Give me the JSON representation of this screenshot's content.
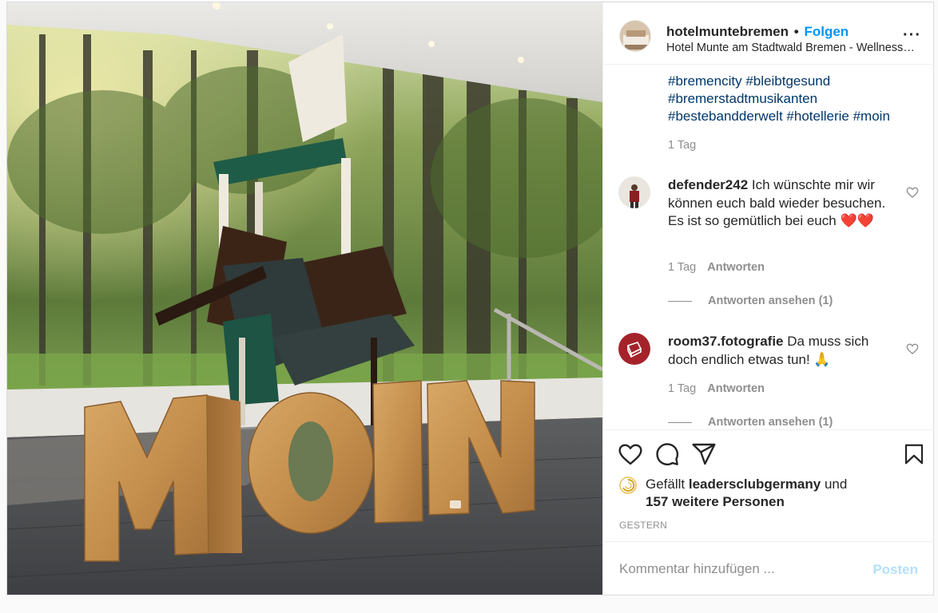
{
  "header": {
    "username": "hotelmuntebremen",
    "separator": "•",
    "follow_label": "Folgen",
    "location": "Hotel Munte am Stadtwald Bremen - Wellness- & Tagungshotel",
    "more_icon": "more-horizontal-icon"
  },
  "caption": {
    "tags": [
      "#bremencity",
      "#bleibtgesund",
      "#bremerstadtmusikanten",
      "#bestebandderwelt",
      "#hotellerie",
      "#moin"
    ],
    "time": "1 Tag"
  },
  "comments": [
    {
      "username": "defender242",
      "text": "Ich wünschte mir wir können euch bald wieder besuchen. Es ist so gemütlich bei euch ❤️❤️",
      "time": "1 Tag",
      "reply_label": "Antworten",
      "view_replies": "Antworten ansehen (1)"
    },
    {
      "username": "room37.fotografie",
      "text": "Da muss sich doch endlich etwas tun! 🙏",
      "time": "1 Tag",
      "reply_label": "Antworten",
      "view_replies": "Antworten ansehen (1)"
    }
  ],
  "actions": {
    "icons": [
      "heart-icon",
      "comment-icon",
      "share-icon",
      "bookmark-icon"
    ],
    "likes_prefix": "Gefällt",
    "likes_user": "leadersclubgermany",
    "likes_and": "und",
    "likes_others": "157 weitere Personen",
    "date": "GESTERN"
  },
  "add_comment": {
    "placeholder": "Kommentar hinzufügen ...",
    "post_label": "Posten"
  },
  "photo": {
    "letters": [
      "M",
      "O",
      "I",
      "N"
    ]
  },
  "colors": {
    "link": "#00376b",
    "accent": "#0095f6",
    "muted": "#8e8e8e",
    "post_disabled": "#b2dffc"
  }
}
